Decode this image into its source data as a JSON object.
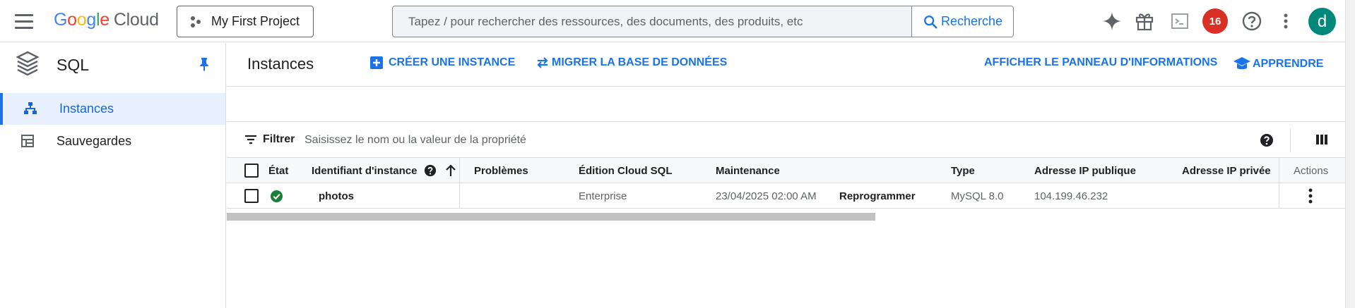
{
  "header": {
    "logo_google": [
      "G",
      "o",
      "o",
      "g",
      "l",
      "e"
    ],
    "logo_cloud": "Cloud",
    "project": "My First Project",
    "search_placeholder": "Tapez / pour rechercher des ressources, des documents, des produits, etc",
    "search_button": "Recherche",
    "notifications_count": "16",
    "avatar_letter": "d"
  },
  "sidebar": {
    "title": "SQL",
    "items": [
      {
        "label": "Instances",
        "icon": "instances-icon",
        "active": true
      },
      {
        "label": "Sauvegardes",
        "icon": "backups-icon",
        "active": false
      }
    ]
  },
  "main": {
    "title": "Instances",
    "create_instance": "CRÉER UNE INSTANCE",
    "migrate_db": "MIGRER LA BASE DE DONNÉES",
    "info_panel": "AFFICHER LE PANNEAU D'INFORMATIONS",
    "learn": "APPRENDRE"
  },
  "filter": {
    "label": "Filtrer",
    "placeholder": "Saisissez le nom ou la valeur de la propriété"
  },
  "table": {
    "columns": {
      "state": "État",
      "instance_id": "Identifiant d'instance",
      "problems": "Problèmes",
      "edition": "Édition Cloud SQL",
      "maintenance": "Maintenance",
      "type": "Type",
      "public_ip": "Adresse IP publique",
      "private_ip": "Adresse IP privée",
      "actions": "Actions"
    },
    "rows": [
      {
        "status": "ok",
        "instance_id": "photos",
        "problems": "",
        "edition": "Enterprise",
        "maintenance": "23/04/2025 02:00 AM",
        "maintenance_action": "Reprogrammer",
        "type": "MySQL 8.0",
        "public_ip": "104.199.46.232",
        "private_ip": ""
      }
    ]
  },
  "colors": {
    "accent": "#1a73e8",
    "active_bg": "#e8f0fe",
    "success": "#188038",
    "badge": "#d93025",
    "avatar": "#00897b"
  }
}
